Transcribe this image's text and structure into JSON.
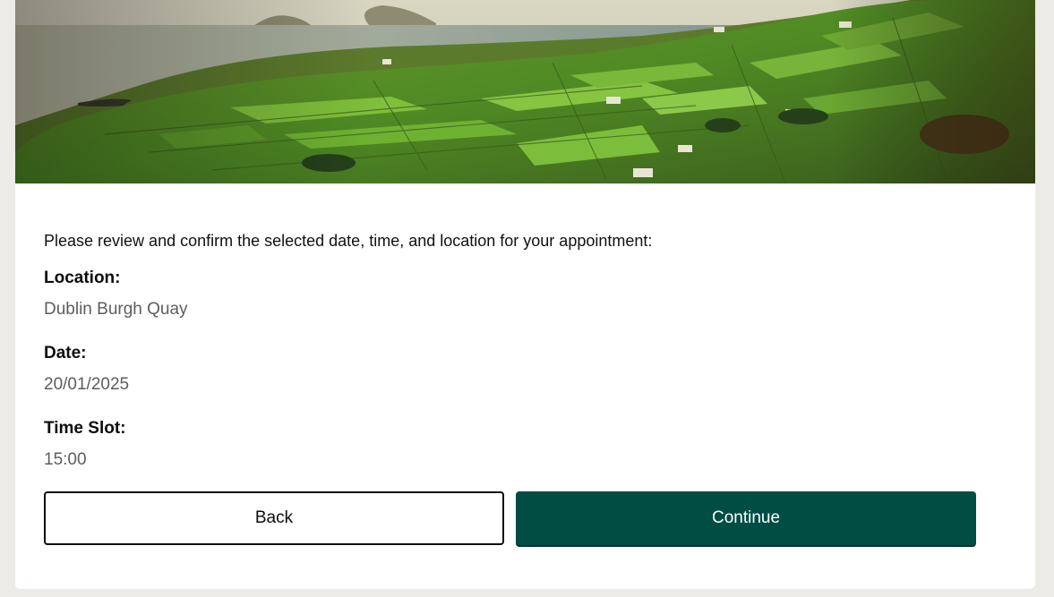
{
  "hero": {
    "image_description": "landscape-photo"
  },
  "confirmation": {
    "intro": "Please review and confirm the selected date, time, and location for your appointment:",
    "location_label": "Location:",
    "location_value": "Dublin Burgh Quay",
    "date_label": "Date:",
    "date_value": "20/01/2025",
    "time_label": "Time Slot:",
    "time_value": "15:00"
  },
  "actions": {
    "back_label": "Back",
    "continue_label": "Continue"
  },
  "colors": {
    "primary": "#004d44",
    "page_background": "#ecebe5",
    "value_text": "#5d5d5d"
  }
}
